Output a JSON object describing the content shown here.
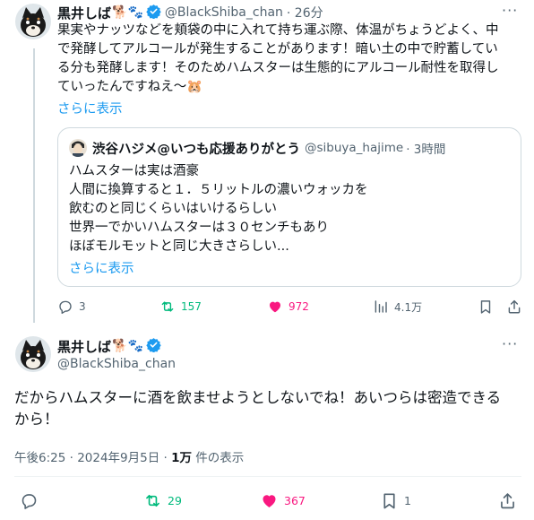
{
  "colors": {
    "blue": "#1d9bf0",
    "green": "#00ba7c",
    "pink": "#f91880",
    "gray": "#536471",
    "border": "#cfd9de"
  },
  "tweet1": {
    "name": "黒井しば",
    "name_emoji": "🐕🐾",
    "handle": "@BlackShiba_chan",
    "time": "· 26分",
    "lines": [
      "果実やナッツなどを頬袋の中に入れて持ち運ぶ際、体温がちょうどよく、中",
      "で発酵してアルコールが発生することがあります！暗い土の中で貯蓄してい",
      "る分も発酵します！そのためハムスターは生態的にアルコール耐性を取得し",
      "ていったんですねえ〜🐹"
    ],
    "show_more": "さらに表示",
    "quote": {
      "name": "渋谷ハジメ@いつも応援ありがとう",
      "handle": "@sibuya_hajime",
      "time": "· 3時間",
      "lines": [
        "ハムスターは実は酒豪",
        "人間に換算すると１．５リットルの濃いウォッカを",
        "飲むのと同じくらいはいけるらしい",
        "世界一でかいハムスターは３０センチもあり",
        "ほぼモルモットと同じ大きさらしい..."
      ],
      "show_more": "さらに表示"
    },
    "actions": {
      "replies": "3",
      "reposts": "157",
      "likes": "972",
      "views": "4.1万"
    }
  },
  "tweet2": {
    "name": "黒井しば",
    "name_emoji": "🐕🐾",
    "handle": "@BlackShiba_chan",
    "lines": [
      "だからハムスターに酒を飲ませようとしないでね！あいつらは密造できる",
      "から！"
    ],
    "meta_time": "午後6:25 · 2024年9月5日 · ",
    "meta_views_count": "1万",
    "meta_views_label": " 件の表示",
    "actions": {
      "reposts": "29",
      "likes": "367",
      "bookmarks": "1"
    }
  }
}
